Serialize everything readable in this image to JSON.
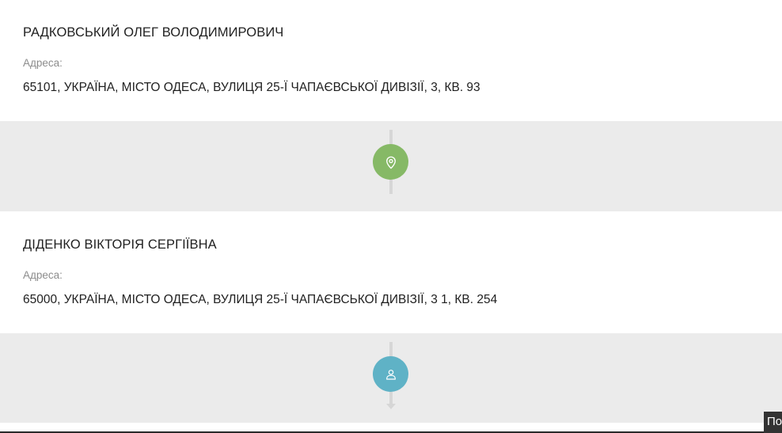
{
  "persons": [
    {
      "name": "РАДКОВСЬКИЙ ОЛЕГ ВОЛОДИМИРОВИЧ",
      "address_label": "Адреса:",
      "address": "65101, УКРАЇНА, МІСТО ОДЕСА, ВУЛИЦЯ 25-Ї ЧАПАЄВСЬКОЇ ДИВІЗІЇ, 3, КВ. 93"
    },
    {
      "name": "ДІДЕНКО ВІКТОРІЯ СЕРГІЇВНА",
      "address_label": "Адреса:",
      "address": "65000, УКРАЇНА, МІСТО ОДЕСА, ВУЛИЦЯ 25-Ї ЧАПАЄВСЬКОЇ ДИВІЗІЇ, 3 1, КВ. 254"
    }
  ],
  "connectors": [
    {
      "icon": "location-pin-icon",
      "color": "#86b966"
    },
    {
      "icon": "user-icon",
      "color": "#5fb2c6"
    }
  ],
  "corner_tooltip": {
    "text": "По"
  },
  "colors": {
    "background": "#ffffff",
    "connector_background": "#ebebeb",
    "connector_line": "#d6d6d6",
    "text_primary": "#1f1f1f",
    "text_secondary": "#8c8c8c"
  }
}
